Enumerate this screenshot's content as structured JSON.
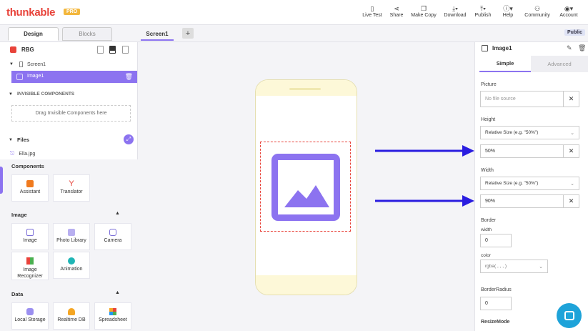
{
  "brand": {
    "name": "thunkable",
    "badge": "PRO"
  },
  "nav": [
    {
      "label": "Live Test",
      "icon": "phone-icon",
      "glyph": "▯"
    },
    {
      "label": "Share",
      "icon": "share-icon",
      "glyph": "⋖"
    },
    {
      "label": "Make Copy",
      "icon": "copy-icon",
      "glyph": "❐"
    },
    {
      "label": "Download",
      "icon": "download-icon",
      "glyph": "⤓▾"
    },
    {
      "label": "Publish",
      "icon": "publish-icon",
      "glyph": "⤒▾"
    },
    {
      "label": "Help",
      "icon": "help-icon",
      "glyph": "ⓘ▾"
    },
    {
      "label": "Community",
      "icon": "community-icon",
      "glyph": "⚇"
    },
    {
      "label": "Account",
      "icon": "account-icon",
      "glyph": "◉▾"
    }
  ],
  "tabs": {
    "design": "Design",
    "blocks": "Blocks"
  },
  "screen_tab": "Screen1",
  "add_screen": "+",
  "visibility": "Public",
  "left": {
    "project": "RBG",
    "screen": "Screen1",
    "selected": "Image1",
    "invisible_header": "INVISIBLE COMPONENTS",
    "invisible_drop": "Drag Invisible Components here",
    "files_header": "Files",
    "file": "Ella.jpg",
    "components_header": "Components",
    "ai": [
      {
        "label": "Assistant",
        "icon": "assistant-icon",
        "color": "#f07a1e"
      },
      {
        "label": "Translator",
        "icon": "translator-icon",
        "color": "#e8433a"
      }
    ],
    "image_header": "Image",
    "image_items": [
      {
        "label": "Image",
        "icon": "image-icon",
        "color": "#7c6fd8"
      },
      {
        "label": "Photo Library",
        "icon": "photo-library-icon",
        "color": "#7c6fd8"
      },
      {
        "label": "Camera",
        "icon": "camera-icon",
        "color": "#7c6fd8"
      },
      {
        "label": "Image Recognizer",
        "icon": "image-recognizer-icon",
        "color": "#4caf50"
      },
      {
        "label": "Animation",
        "icon": "animation-icon",
        "color": "#1fb5b5"
      }
    ],
    "data_header": "Data",
    "data_items": [
      {
        "label": "Local Storage",
        "icon": "local-storage-icon",
        "color": "#7c6fd8"
      },
      {
        "label": "Realtime DB",
        "icon": "realtime-db-icon",
        "color": "#f5a623"
      },
      {
        "label": "Spreadsheet",
        "icon": "spreadsheet-icon",
        "color": "#e8433a"
      }
    ]
  },
  "right": {
    "title": "Image1",
    "tab_simple": "Simple",
    "tab_advanced": "Advanced",
    "picture_label": "Picture",
    "picture_value": "No file source",
    "height_label": "Height",
    "height_mode": "Relative Size (e.g. \"50%\")",
    "height_value": "50%",
    "width_label": "Width",
    "width_mode": "Relative Size (e.g. \"50%\")",
    "width_value": "90%",
    "border_label": "Border",
    "border_width_label": "width",
    "border_width_value": "0",
    "border_color_label": "color",
    "border_color_value": "rgba( , , , )",
    "radius_label": "BorderRadius",
    "radius_value": "0",
    "resize_label": "ResizeMode"
  },
  "colors": {
    "accent": "#8c73f0",
    "arrow": "#2a1de0",
    "phone": "#fdf8d8"
  }
}
